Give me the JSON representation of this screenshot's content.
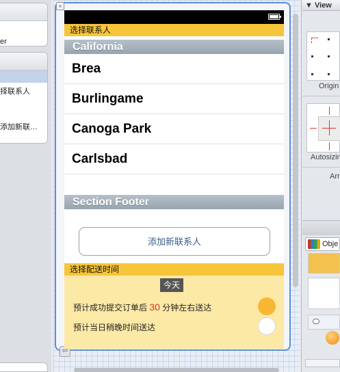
{
  "outline": {
    "item_top_text": "er",
    "item_selected_text": "择联系人",
    "item_add_text": "添加新联…"
  },
  "storyboard": {
    "nav_bar_title": "选择联系人",
    "section_header": "California",
    "cities": [
      "Brea",
      "Burlingame",
      "Canoga Park",
      "Carlsbad"
    ],
    "section_footer": "Section Footer",
    "add_contact_button": "添加新联系人",
    "delivery_header": "选择配送时间",
    "today_badge": "今天",
    "option_1_prefix": "预计成功提交订单后",
    "option_1_minutes": "30",
    "option_1_suffix": "分钟左右送达",
    "option_2_text": "预计当日稍晚时间送达",
    "option_1_selected": true,
    "option_2_selected": false
  },
  "inspector": {
    "view_header": "View",
    "origin_label": "Origin",
    "autosizing_label": "Autosizing",
    "arrange_label": "Arr"
  },
  "library": {
    "filter_label": "Obje"
  },
  "colors": {
    "accent_yellow": "#f7c53a",
    "delivery_bg": "#fde9a6",
    "selected_radio": "#f7b733",
    "minutes_highlight": "#d0342c",
    "scene_border": "#5b8fd6"
  }
}
